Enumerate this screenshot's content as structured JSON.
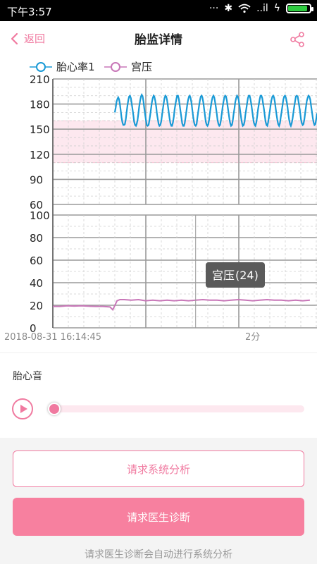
{
  "status_bar": {
    "time": "下午3:57",
    "signal_label": "..il"
  },
  "nav": {
    "back_label": "返回",
    "title": "胎监详情"
  },
  "legend": {
    "fhr_label": "胎心率1",
    "toco_label": "宫压"
  },
  "chart_data": {
    "type": "line",
    "fhr": {
      "ticks": [
        "210",
        "180",
        "150",
        "120",
        "90",
        "60"
      ],
      "ylim": [
        60,
        210
      ],
      "normal_band": [
        110,
        160
      ],
      "series_name": "胎心率1",
      "x": [
        0.0,
        0.007,
        0.013,
        0.02,
        0.027,
        0.033,
        0.04,
        0.047,
        0.053,
        0.06,
        0.067,
        0.073,
        0.08,
        0.087,
        0.093,
        0.1,
        0.107,
        0.113,
        0.12,
        0.127,
        0.133,
        0.14,
        0.147,
        0.153,
        0.16,
        0.167,
        0.173,
        0.18,
        0.187,
        0.193,
        0.2,
        0.207,
        0.213,
        0.22,
        0.227,
        0.233,
        0.24,
        0.247,
        0.253,
        0.26,
        0.267,
        0.273,
        0.28,
        0.287,
        0.293,
        0.3,
        0.307,
        0.313,
        0.32,
        0.327,
        0.333,
        0.34,
        0.347,
        0.353,
        0.36,
        0.367,
        0.373,
        0.38,
        0.387,
        0.393,
        0.4,
        0.407,
        0.413,
        0.42,
        0.427,
        0.433,
        0.44,
        0.447,
        0.453,
        0.46,
        0.467,
        0.473,
        0.48,
        0.487,
        0.493,
        0.5,
        0.507,
        0.513,
        0.52,
        0.527,
        0.533,
        0.54,
        0.547,
        0.553,
        0.56,
        0.567,
        0.573,
        0.58,
        0.587,
        0.593,
        0.6,
        0.607,
        0.613,
        0.62,
        0.627,
        0.633,
        0.64,
        0.647,
        0.653,
        0.66,
        0.667,
        0.673,
        0.68,
        0.687,
        0.693,
        0.7,
        0.707,
        0.713,
        0.72,
        0.727,
        0.733,
        0.74,
        0.747,
        0.753,
        0.76,
        0.767,
        0.773,
        0.78,
        0.787,
        0.793,
        0.8,
        0.807,
        0.813,
        0.82,
        0.827,
        0.833,
        0.84,
        0.847,
        0.853,
        0.86,
        0.867,
        0.873,
        0.88,
        0.887,
        0.893,
        0.9,
        0.907,
        0.913,
        0.92,
        0.927,
        0.933,
        0.94,
        0.947,
        0.953,
        0.96,
        0.967,
        0.973,
        0.98,
        0.987,
        0.993,
        1.0,
        1.007,
        1.013,
        1.02,
        1.027,
        1.033,
        1.04,
        1.047,
        1.053,
        1.06,
        1.067,
        1.073,
        1.08,
        1.087,
        1.093,
        1.1,
        1.107,
        1.113,
        1.12,
        1.127,
        1.133,
        1.14,
        1.147,
        1.153,
        1.16,
        1.167,
        1.173,
        1.18,
        1.187,
        1.193,
        1.2,
        1.207,
        1.213,
        1.22,
        1.227,
        1.233,
        1.24,
        1.247,
        1.253,
        1.26,
        1.267,
        1.273,
        1.28,
        1.287,
        1.293,
        1.3,
        1.307,
        1.313,
        1.32,
        1.327,
        1.333,
        1.34,
        1.347,
        1.353,
        1.36,
        1.367,
        1.373,
        1.38,
        1.387,
        1.393,
        1.4,
        1.407,
        1.413,
        1.42,
        1.427,
        1.433,
        1.44,
        1.447,
        1.453,
        1.46,
        1.467,
        1.473,
        1.48,
        1.487,
        1.493,
        1.5,
        1.507,
        1.513,
        1.52,
        1.527,
        1.533,
        1.54,
        1.547,
        1.553,
        1.56,
        1.567,
        1.573,
        1.58,
        1.587,
        1.593,
        1.6,
        1.607,
        1.613,
        1.62,
        1.627,
        1.633,
        1.64,
        1.647,
        1.653,
        1.66,
        1.667,
        1.673,
        1.68,
        1.687,
        1.693,
        1.7,
        1.707,
        1.713,
        1.72,
        1.727,
        1.733,
        1.74,
        1.747,
        1.753,
        1.76,
        1.767,
        1.773,
        1.78,
        1.787,
        1.793,
        1.8
      ],
      "values": [
        170,
        176,
        182,
        186,
        188,
        186,
        180,
        172,
        164,
        158,
        155,
        155,
        156,
        162,
        170,
        178,
        185,
        189,
        190,
        187,
        181,
        174,
        166,
        159,
        155,
        154,
        156,
        161,
        169,
        177,
        184,
        189,
        191,
        189,
        183,
        175,
        167,
        160,
        155,
        154,
        155,
        160,
        167,
        175,
        182,
        187,
        190,
        189,
        184,
        177,
        169,
        162,
        156,
        154,
        155,
        159,
        166,
        174,
        181,
        187,
        190,
        189,
        185,
        178,
        170,
        163,
        157,
        154,
        154,
        158,
        165,
        173,
        180,
        186,
        190,
        190,
        186,
        179,
        171,
        164,
        157,
        154,
        154,
        157,
        164,
        172,
        179,
        185,
        189,
        190,
        187,
        181,
        173,
        165,
        158,
        155,
        154,
        156,
        163,
        171,
        178,
        184,
        189,
        190,
        188,
        182,
        174,
        167,
        159,
        155,
        154,
        156,
        162,
        170,
        177,
        184,
        188,
        190,
        188,
        183,
        176,
        168,
        161,
        156,
        154,
        155,
        161,
        169,
        176,
        183,
        188,
        190,
        189,
        184,
        177,
        170,
        162,
        157,
        154,
        155,
        160,
        168,
        175,
        182,
        187,
        190,
        189,
        185,
        178,
        171,
        163,
        157,
        154,
        155,
        159,
        167,
        174,
        181,
        187,
        190,
        190,
        186,
        180,
        172,
        165,
        158,
        155,
        154,
        158,
        166,
        173,
        180,
        186,
        190,
        190,
        187,
        181,
        174,
        166,
        159,
        155,
        154,
        158,
        165,
        172,
        179,
        185,
        189,
        190,
        188,
        182,
        175,
        167,
        160,
        156,
        154,
        157,
        164,
        171,
        178,
        185,
        189,
        190,
        188,
        183,
        176,
        168,
        161,
        156,
        154,
        157,
        163,
        170,
        177,
        184,
        189,
        190,
        189,
        184,
        177,
        170,
        162,
        157,
        155,
        156,
        162,
        170,
        177,
        184,
        188,
        190,
        189,
        185,
        178,
        171,
        163,
        158,
        155,
        156,
        161,
        169,
        176,
        183,
        188,
        190,
        189,
        185,
        179,
        172,
        164,
        158,
        155,
        155,
        161,
        168,
        175,
        182,
        187,
        190,
        190,
        186,
        180,
        173,
        165,
        159,
        155,
        155,
        160,
        167,
        174
      ]
    },
    "toco": {
      "ticks": [
        "100",
        "80",
        "60",
        "40",
        "20",
        "0"
      ],
      "ylim": [
        0,
        100
      ],
      "series_name": "宫压",
      "x": [
        0.0,
        0.05,
        0.1,
        0.15,
        0.2,
        0.25,
        0.3,
        0.35,
        0.4,
        0.42,
        0.45,
        0.47,
        0.5,
        0.55,
        0.6,
        0.65,
        0.7,
        0.75,
        0.8,
        0.85,
        0.9,
        0.95,
        1.0,
        1.05,
        1.1,
        1.15,
        1.2,
        1.25,
        1.3,
        1.35,
        1.4,
        1.45,
        1.5,
        1.55,
        1.6,
        1.65,
        1.7,
        1.75,
        1.8
      ],
      "values": [
        19,
        19,
        19.5,
        19.3,
        19.5,
        19.2,
        19,
        19,
        18.5,
        16,
        24,
        25,
        25,
        24.5,
        25,
        24,
        24.5,
        24,
        24.5,
        24,
        24.5,
        24,
        24.5,
        25,
        24.5,
        24.5,
        24,
        24.5,
        25,
        24.5,
        24,
        24.5,
        25,
        24.5,
        24.5,
        24,
        24.5,
        24,
        24.5
      ]
    },
    "x_labels": {
      "start": "2018-08-31 16:14:45",
      "mark": "2分"
    },
    "tooltip": {
      "label": "宫压",
      "value": "(24)",
      "x": 1.0
    },
    "grid": true,
    "fhr_color": "#1a9ad6",
    "toco_color": "#c877b8"
  },
  "audio": {
    "label": "胎心音",
    "progress": 0
  },
  "buttons": {
    "system_analysis": "请求系统分析",
    "doctor_diagnosis": "请求医生诊断"
  },
  "hint": "请求医生诊断会自动进行系统分析",
  "colors": {
    "accent": "#f07aa0",
    "band": "#fde8ef"
  }
}
